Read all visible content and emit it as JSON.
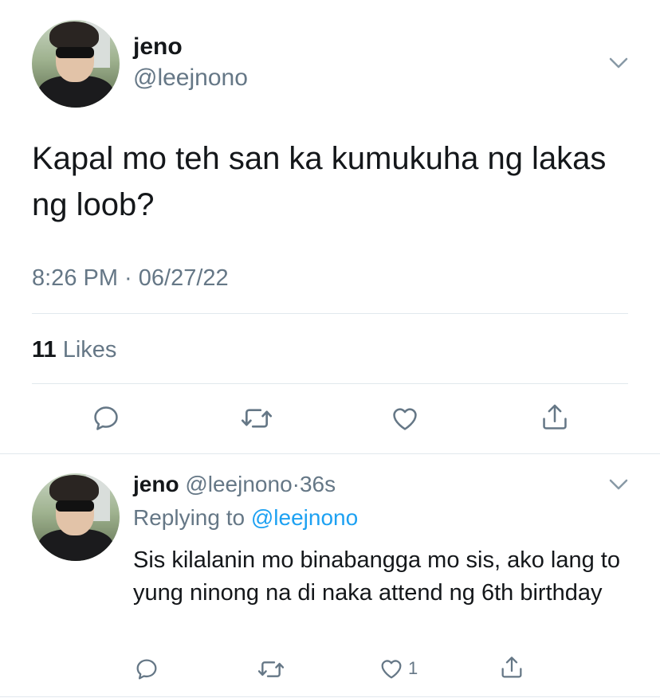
{
  "main_tweet": {
    "author_name": "jeno",
    "author_handle": "@leejnono",
    "text": "Kapal mo teh san ka kumukuha ng lakas ng loob?",
    "timestamp": "8:26 PM · 06/27/22",
    "likes_count": "11",
    "likes_label": "Likes",
    "actions": [
      "reply-icon",
      "retweet-icon",
      "like-icon",
      "share-icon"
    ]
  },
  "reply_tweet": {
    "author_name": "jeno",
    "author_handle": "@leejnono",
    "separator": "·",
    "time_ago": "36s",
    "replying_label": "Replying to",
    "replying_to": "@leejnono",
    "text": "Sis kilalanin mo binabangga mo sis, ako lang to yung ninong na di naka attend ng 6th birthday",
    "like_count": "1",
    "actions": [
      "reply-icon",
      "retweet-icon",
      "like-icon",
      "share-icon"
    ]
  },
  "colors": {
    "text_primary": "#14171a",
    "text_secondary": "#657786",
    "link": "#1da1f2",
    "divider": "#e1e8ed"
  }
}
